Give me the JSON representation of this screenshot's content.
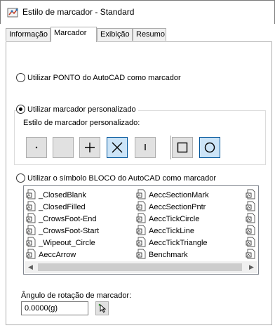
{
  "window": {
    "title": "Estilo de marcador - Standard"
  },
  "tabs": [
    {
      "label": "Informação"
    },
    {
      "label": "Marcador"
    },
    {
      "label": "Exibição"
    },
    {
      "label": "Resumo"
    }
  ],
  "options": {
    "point_label": "Utilizar PONTO do AutoCAD como marcador",
    "custom_label": "Utilizar marcador personalizado",
    "custom_style_label": "Estilo de marcador personalizado:",
    "block_label": "Utilizar o símbolo BLOCO do AutoCAD como marcador",
    "selected": "custom"
  },
  "blocks": {
    "column1": [
      "_ClosedBlank",
      "_ClosedFilled",
      "_CrowsFoot-End",
      "_CrowsFoot-Start",
      "_Wipeout_Circle",
      "AeccArrow"
    ],
    "column2": [
      "AeccSectionMark",
      "AeccSectionPntr",
      "AeccTickCircle",
      "AeccTickLine",
      "AeccTickTriangle",
      "Benchmark"
    ]
  },
  "rotation": {
    "label": "Ângulo de rotação de marcador:",
    "value": "0.0000(g)"
  },
  "colors": {
    "accent": "#005499",
    "selected_bg": "#cce4f7"
  }
}
